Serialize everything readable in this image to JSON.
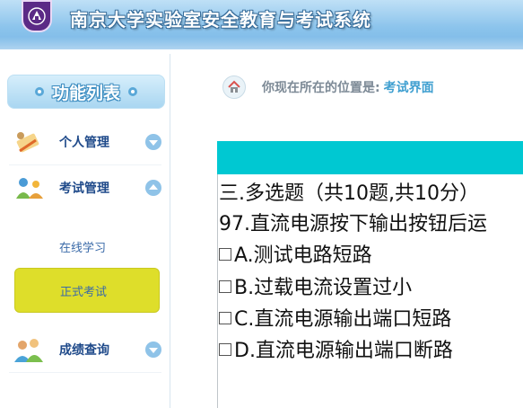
{
  "header": {
    "title": "南京大学实验室安全教育与考试系统",
    "logo_icon": "university-emblem-icon"
  },
  "sidebar": {
    "menu_title": "功能列表",
    "items": [
      {
        "label": "个人管理",
        "icon": "personal-management-icon",
        "expanded": false
      },
      {
        "label": "考试管理",
        "icon": "exam-management-icon",
        "expanded": true
      },
      {
        "label": "成绩查询",
        "icon": "score-query-icon",
        "expanded": false
      }
    ],
    "sub_items": [
      {
        "label": "在线学习",
        "active": false
      },
      {
        "label": "正式考试",
        "active": true
      }
    ]
  },
  "breadcrumb": {
    "prefix": "你现在所在的位置是:",
    "current": "考试界面"
  },
  "exam": {
    "section": "三.多选题（共10题,共10分）",
    "question": "97.直流电源按下输出按钮后运",
    "options": [
      {
        "label": "A.测试电路短路",
        "checked": false
      },
      {
        "label": "B.过载电流设置过小",
        "checked": false
      },
      {
        "label": "C.直流电源输出端口短路",
        "checked": false
      },
      {
        "label": "D.直流电源输出端口断路",
        "checked": false
      }
    ]
  },
  "colors": {
    "accent_bar": "#00c8d2",
    "active_menu": "#dede2a",
    "header": "#8cc4ec"
  }
}
